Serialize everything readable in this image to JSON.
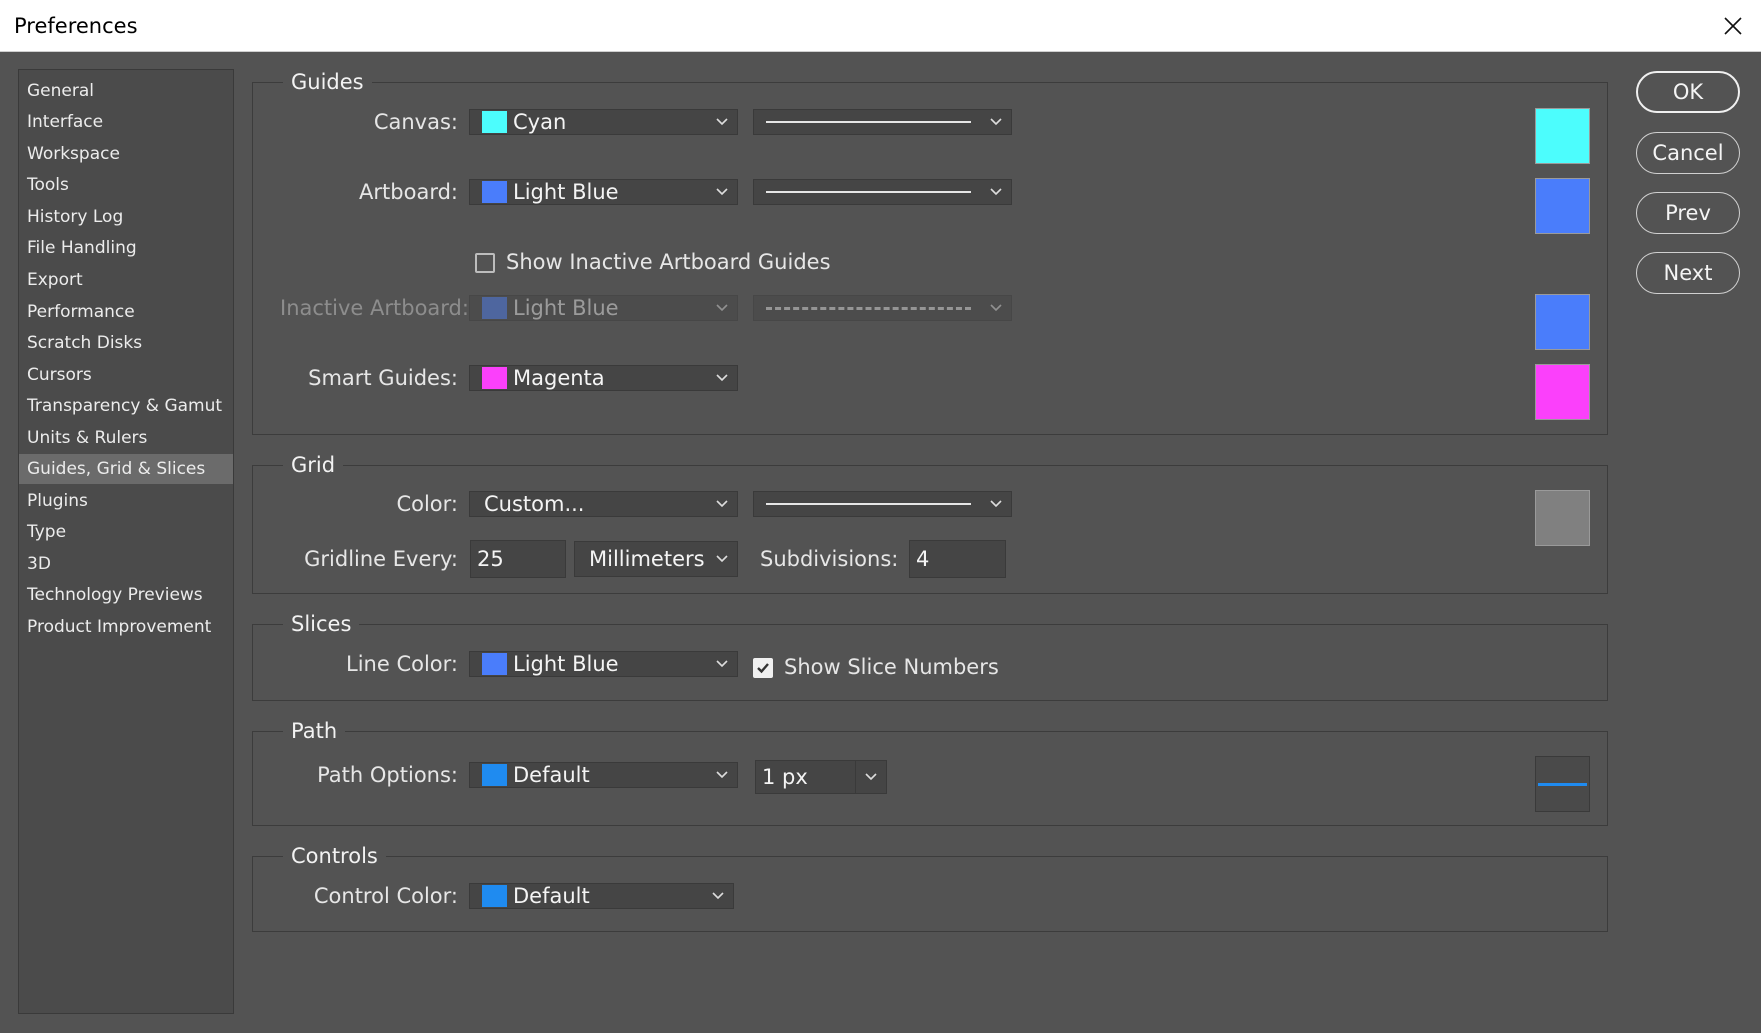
{
  "window": {
    "title": "Preferences"
  },
  "sidebar": {
    "items": [
      {
        "label": "General"
      },
      {
        "label": "Interface"
      },
      {
        "label": "Workspace"
      },
      {
        "label": "Tools"
      },
      {
        "label": "History Log"
      },
      {
        "label": "File Handling"
      },
      {
        "label": "Export"
      },
      {
        "label": "Performance"
      },
      {
        "label": "Scratch Disks"
      },
      {
        "label": "Cursors"
      },
      {
        "label": "Transparency & Gamut"
      },
      {
        "label": "Units & Rulers"
      },
      {
        "label": "Guides, Grid & Slices"
      },
      {
        "label": "Plugins"
      },
      {
        "label": "Type"
      },
      {
        "label": "3D"
      },
      {
        "label": "Technology Previews"
      },
      {
        "label": "Product Improvement"
      }
    ],
    "selected": "Guides, Grid & Slices"
  },
  "guides": {
    "title": "Guides",
    "canvas": {
      "label": "Canvas:",
      "color": "Cyan",
      "swatch": "#4cfdfd",
      "line_style": "solid"
    },
    "artboard": {
      "label": "Artboard:",
      "color": "Light Blue",
      "swatch": "#4a7dfb",
      "line_style": "solid"
    },
    "show_inactive": {
      "label": "Show Inactive Artboard Guides",
      "checked": false
    },
    "inactive_artboard": {
      "label": "Inactive Artboard:",
      "color": "Light Blue",
      "swatch": "#4a7dfb",
      "line_style": "dashed"
    },
    "smart_guides": {
      "label": "Smart Guides:",
      "color": "Magenta",
      "swatch": "#fb40fb"
    }
  },
  "grid": {
    "title": "Grid",
    "color": {
      "label": "Color:",
      "value": "Custom...",
      "swatch": "#808080",
      "line_style": "solid"
    },
    "gridline": {
      "label": "Gridline Every:",
      "value": "25",
      "unit": "Millimeters"
    },
    "subdivisions": {
      "label": "Subdivisions:",
      "value": "4"
    }
  },
  "slices": {
    "title": "Slices",
    "line_color": {
      "label": "Line Color:",
      "color": "Light Blue",
      "swatch": "#4a7dfb"
    },
    "show_numbers": {
      "label": "Show Slice Numbers",
      "checked": true
    }
  },
  "path": {
    "title": "Path",
    "options": {
      "label": "Path Options:",
      "color": "Default",
      "swatch": "#1f8bf0",
      "width": "1 px"
    }
  },
  "controls": {
    "title": "Controls",
    "color": {
      "label": "Control Color:",
      "value": "Default",
      "swatch": "#1f8bf0"
    }
  },
  "buttons": {
    "ok": "OK",
    "cancel": "Cancel",
    "prev": "Prev",
    "next": "Next"
  }
}
